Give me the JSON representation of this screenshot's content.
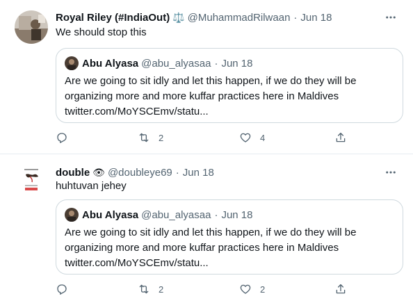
{
  "tweets": [
    {
      "display_name": "Royal Riley (#IndiaOut)",
      "name_emoji": "⚖️",
      "handle": "@MuhammadRilwaan",
      "separator": "·",
      "date": "Jun 18",
      "text": "We should stop this",
      "quote": {
        "display_name": "Abu Alyasa",
        "handle": "@abu_alyasaa",
        "separator": "·",
        "date": "Jun 18",
        "lines": [
          "Are we going to sit idly and let this happen, if we do they will be",
          "organizing more and more kuffar practices here in Maldives",
          "twitter.com/MoYSCEmv/statu..."
        ]
      },
      "actions": {
        "reply_count": "",
        "retweet_count": "2",
        "like_count": "4"
      }
    },
    {
      "display_name": "double",
      "name_emoji": "👁",
      "handle": "@doubleye69",
      "separator": "·",
      "date": "Jun 18",
      "text": "huhtuvan jehey",
      "quote": {
        "display_name": "Abu Alyasa",
        "handle": "@abu_alyasaa",
        "separator": "·",
        "date": "Jun 18",
        "lines": [
          "Are we going to sit idly and let this happen, if we do they will be",
          "organizing more and more kuffar practices here in Maldives",
          "twitter.com/MoYSCEmv/statu..."
        ]
      },
      "actions": {
        "reply_count": "",
        "retweet_count": "2",
        "like_count": "2"
      }
    }
  ],
  "icons": {
    "more": "more-horizontal-icon",
    "reply": "reply-icon",
    "retweet": "retweet-icon",
    "like": "heart-icon",
    "share": "share-icon"
  },
  "colors": {
    "text": "#0f1419",
    "secondary": "#536471",
    "border": "#cfd9de",
    "divider": "#e6ecf0"
  }
}
